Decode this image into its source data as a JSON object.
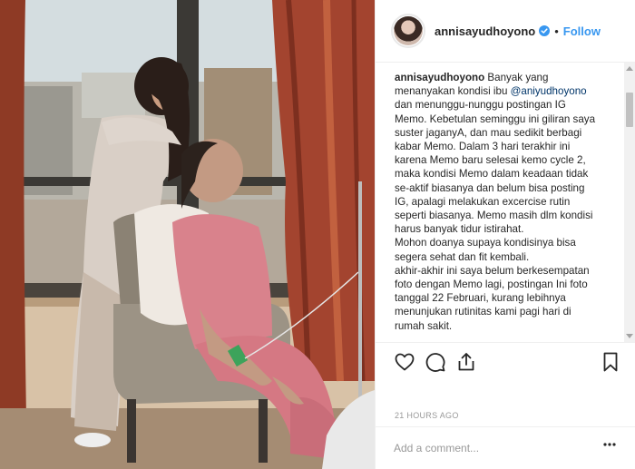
{
  "post": {
    "username": "annisayudhoyono",
    "follow_label": "Follow",
    "separator": "•",
    "caption_lines": [
      {
        "parts": [
          {
            "t": "annisayudhoyono",
            "b": true
          },
          {
            "t": " Banyak yang"
          }
        ]
      },
      {
        "parts": [
          {
            "t": "menanyakan kondisi ibu "
          },
          {
            "t": "@aniyudhoyono",
            "m": true
          }
        ]
      },
      {
        "parts": [
          {
            "t": "dan menunggu-nunggu postingan IG"
          }
        ]
      },
      {
        "parts": [
          {
            "t": "Memo. Kebetulan seminggu ini giliran saya"
          }
        ]
      },
      {
        "parts": [
          {
            "t": "suster jaganyA, dan mau sedikit berbagi"
          }
        ]
      },
      {
        "parts": [
          {
            "t": "kabar Memo. Dalam 3 hari terakhir ini"
          }
        ]
      },
      {
        "parts": [
          {
            "t": "karena Memo baru selesai kemo cycle 2,"
          }
        ]
      },
      {
        "parts": [
          {
            "t": "maka kondisi Memo dalam keadaan tidak"
          }
        ]
      },
      {
        "parts": [
          {
            "t": "se-aktif biasanya dan belum bisa posting"
          }
        ]
      },
      {
        "parts": [
          {
            "t": "IG, apalagi melakukan excercise rutin"
          }
        ]
      },
      {
        "parts": [
          {
            "t": "seperti biasanya. Memo masih dlm kondisi"
          }
        ]
      },
      {
        "parts": [
          {
            "t": "harus banyak tidur istirahat."
          }
        ]
      },
      {
        "parts": [
          {
            "t": "Mohon doanya supaya kondisinya bisa"
          }
        ]
      },
      {
        "parts": [
          {
            "t": "segera sehat dan fit kembali."
          }
        ]
      },
      {
        "parts": [
          {
            "t": "akhir-akhir ini saya belum berkesempatan"
          }
        ]
      },
      {
        "parts": [
          {
            "t": "foto dengan Memo lagi, postingan Ini foto"
          }
        ]
      },
      {
        "parts": [
          {
            "t": "tanggal 22 Februari, kurang lebihnya"
          }
        ]
      },
      {
        "parts": [
          {
            "t": "menunjukan rutinitas kami pagi hari di"
          }
        ]
      },
      {
        "parts": [
          {
            "t": "rumah sakit."
          }
        ]
      }
    ],
    "time_ago": "21 HOURS AGO",
    "comment_placeholder": "Add a comment..."
  },
  "icons": {
    "verified": "verified-badge-icon",
    "like": "heart-icon",
    "comment": "speech-bubble-icon",
    "share": "share-icon",
    "save": "bookmark-icon",
    "more": "more-options-icon"
  },
  "colors": {
    "accent": "#3897f0",
    "text": "#262626",
    "muted": "#999999",
    "border": "#efefef"
  }
}
